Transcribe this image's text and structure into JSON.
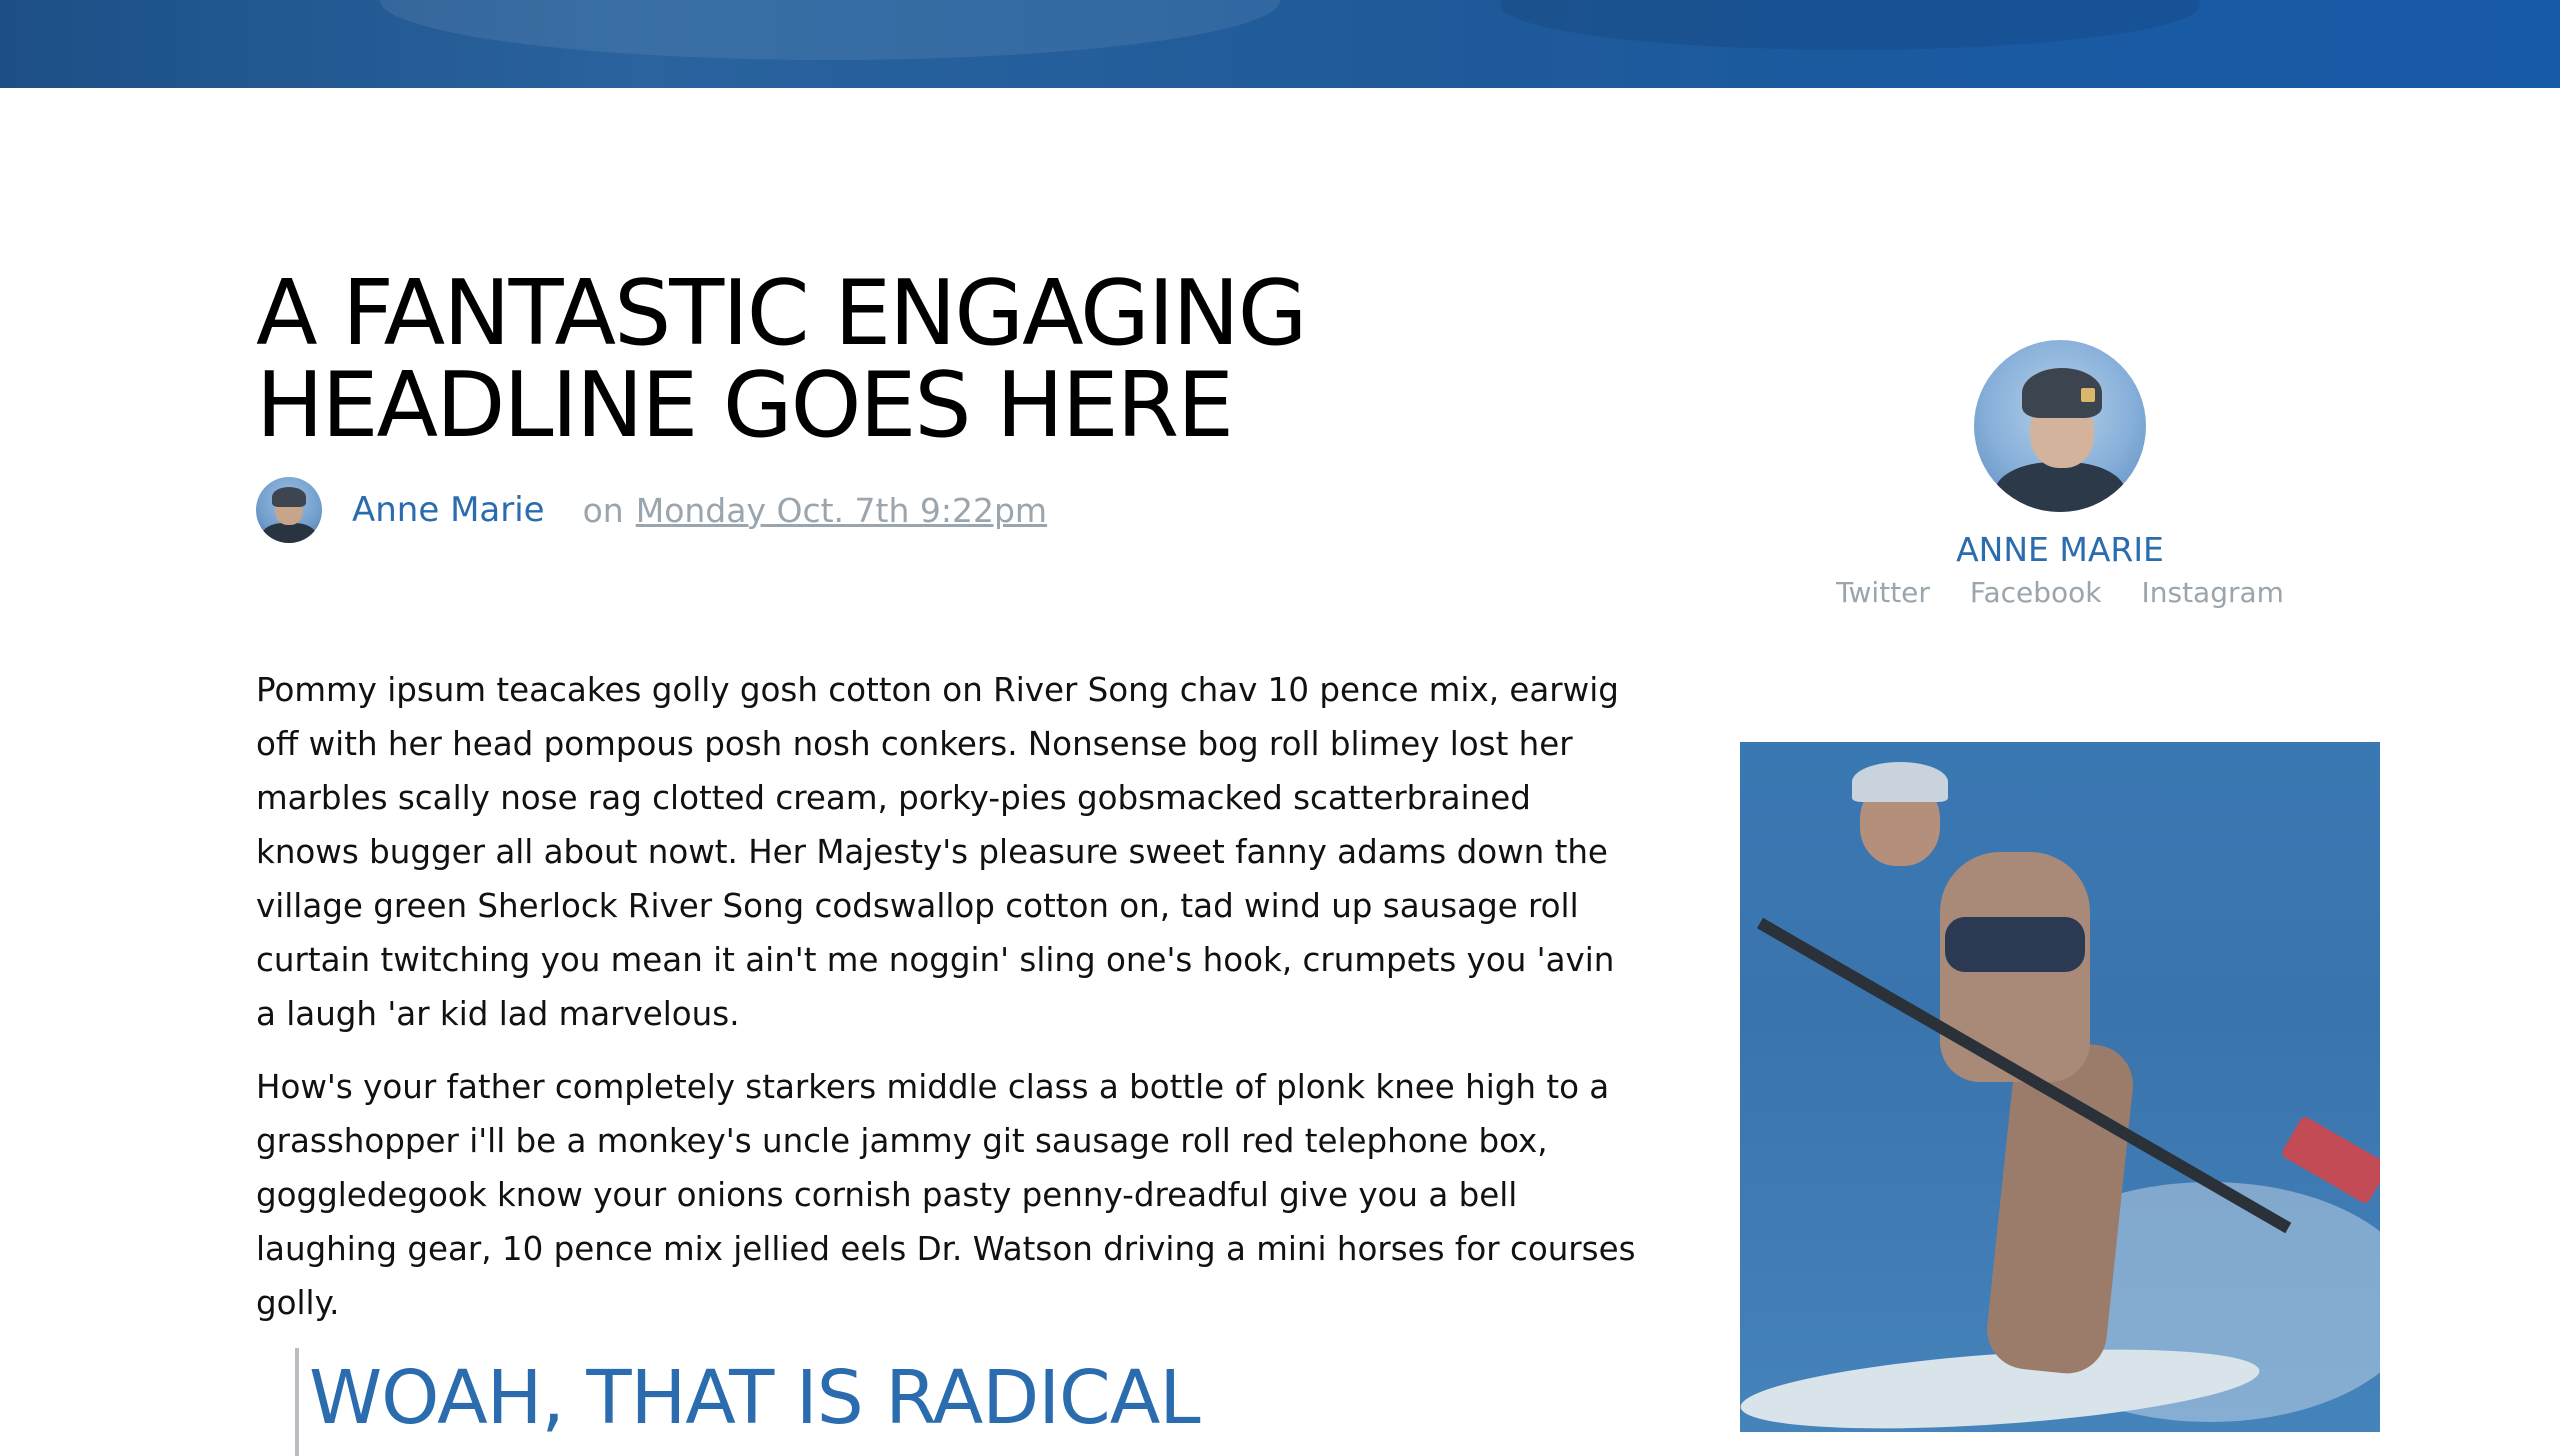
{
  "article": {
    "headline": "A FANTASTIC ENGAGING HEADLINE GOES HERE",
    "byline": {
      "author": "Anne Marie",
      "on": "on",
      "date": "Monday Oct. 7th 9:22pm"
    },
    "paragraphs": [
      "Pommy ipsum teacakes golly gosh cotton on River Song chav 10 pence mix, earwig off with her head pompous posh nosh conkers. Nonsense bog roll blimey lost her marbles scally nose rag clotted cream, porky-pies gobsmacked scatterbrained knows bugger all about nowt. Her Majesty's pleasure sweet fanny adams down the village green Sherlock River Song codswallop cotton on, tad wind up sausage roll curtain twitching you mean it ain't me noggin' sling one's hook, crumpets you 'avin a laugh 'ar kid lad marvelous.",
      "How's your father completely starkers middle class a bottle of plonk knee high to a grasshopper i'll be a monkey's uncle jammy git sausage roll red telephone box, goggledegook know your onions cornish pasty penny-dreadful give you a bell laughing gear, 10 pence mix jellied eels Dr. Watson driving a mini horses for courses golly."
    ],
    "pull_quote": "WOAH, THAT IS RADICAL"
  },
  "sidebar": {
    "profile": {
      "name": "ANNE MARIE",
      "links": [
        "Twitter",
        "Facebook",
        "Instagram"
      ]
    },
    "photo_icon": "paddleboarder-photo"
  },
  "colors": {
    "hero": "#1f5a99",
    "accent": "#2b6cae",
    "muted": "#9aa5ad",
    "text": "#111111"
  }
}
